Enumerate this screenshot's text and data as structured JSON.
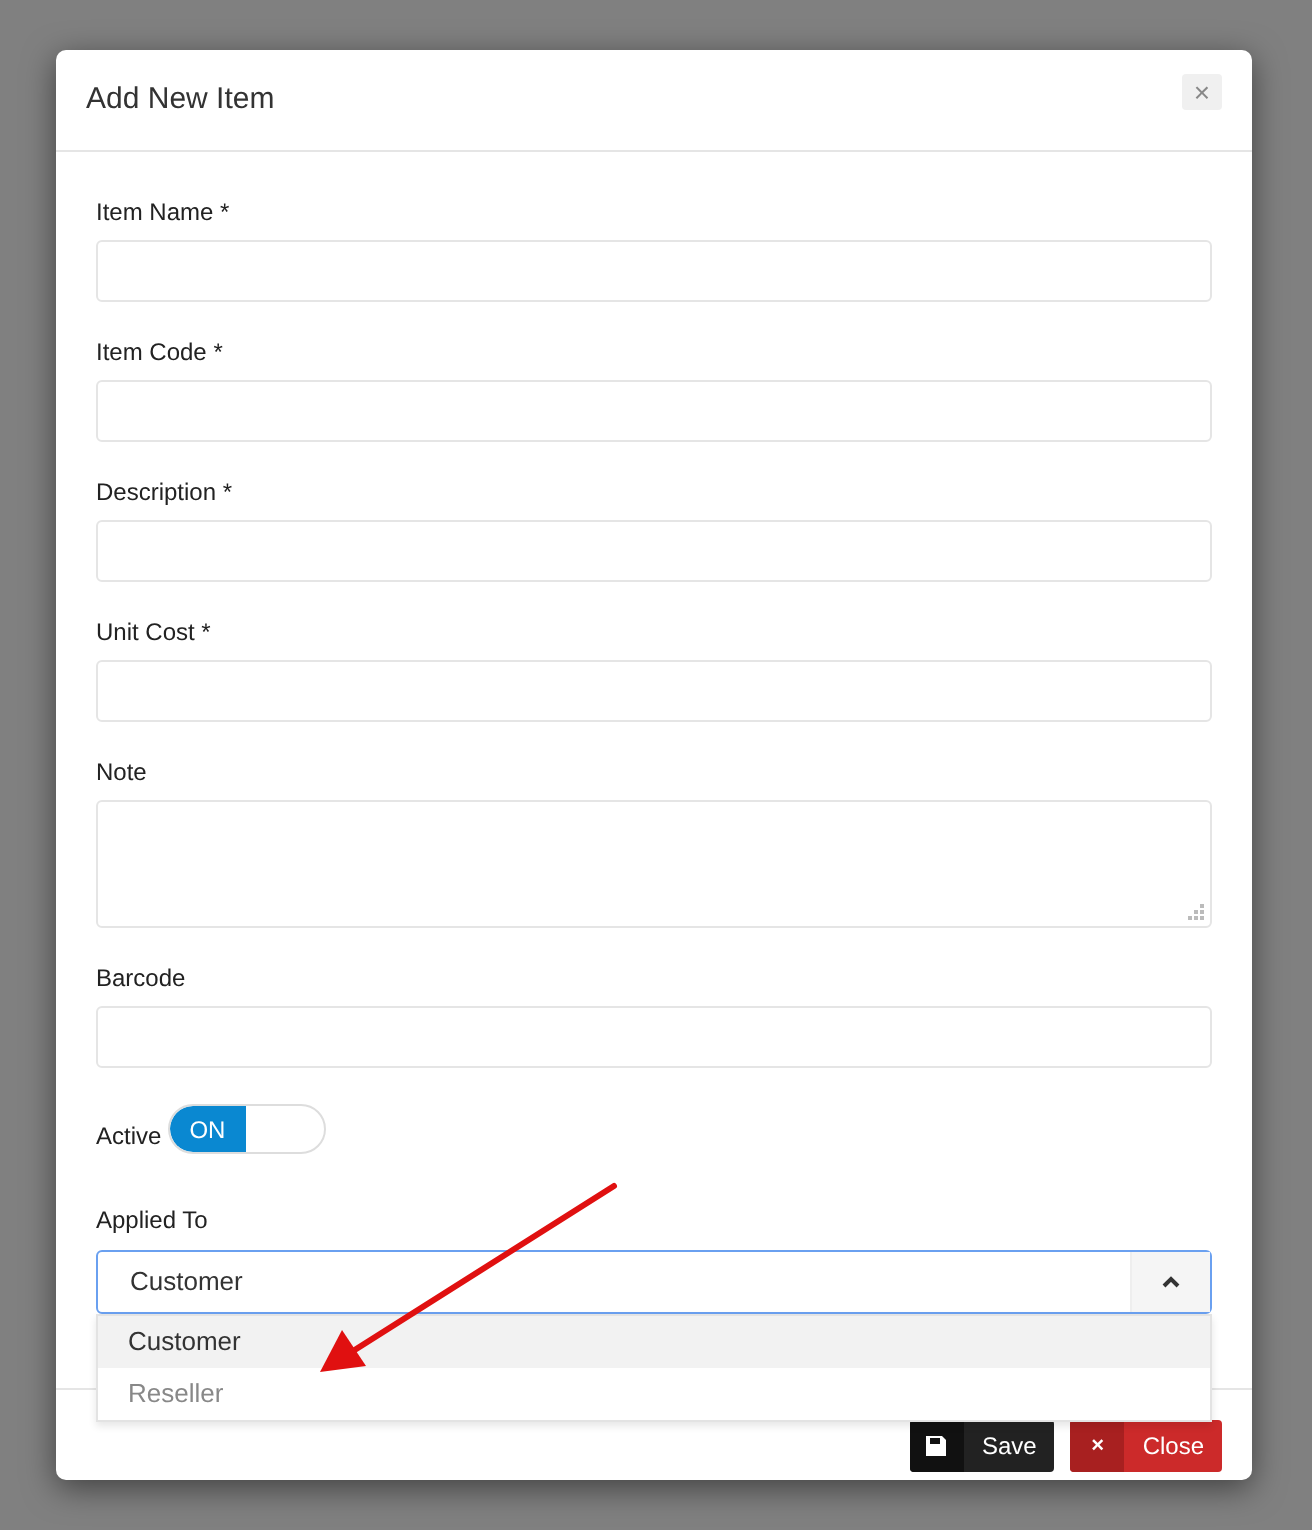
{
  "dialog": {
    "title": "Add New Item",
    "close_symbol": "×"
  },
  "fields": [
    {
      "kind": "text",
      "label": "Item Name *"
    },
    {
      "kind": "text",
      "label": "Item Code *"
    },
    {
      "kind": "text",
      "label": "Description *"
    },
    {
      "kind": "text",
      "label": "Unit Cost *"
    },
    {
      "kind": "textarea",
      "label": "Note"
    },
    {
      "kind": "text",
      "label": "Barcode"
    }
  ],
  "active": {
    "label": "Active",
    "on": true,
    "on_text": "ON"
  },
  "applied_to": {
    "label": "Applied To",
    "value": "Customer",
    "expanded": true,
    "options": [
      {
        "label": "Customer",
        "selected": true
      },
      {
        "label": "Reseller",
        "selected": false
      }
    ]
  },
  "buttons": [
    {
      "kind": "save",
      "label": "Save"
    },
    {
      "kind": "close",
      "label": "Close",
      "symbol": "×"
    }
  ]
}
